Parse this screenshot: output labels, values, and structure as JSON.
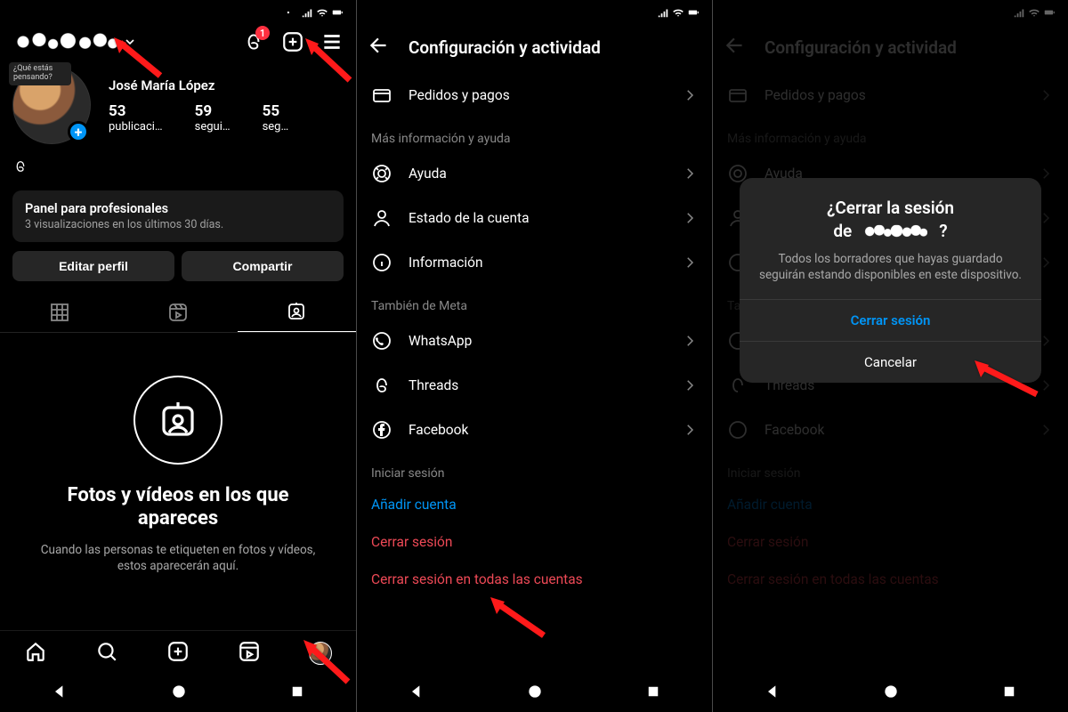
{
  "status": {
    "badge": "1"
  },
  "profile": {
    "story_prompt": "¿Qué estás pensando?",
    "display_name": "José María López",
    "stats": {
      "posts": {
        "num": "53",
        "label": "publicaci…"
      },
      "followers": {
        "num": "59",
        "label": "segui…"
      },
      "following": {
        "num": "55",
        "label": "seg…"
      }
    },
    "pro_panel": {
      "title": "Panel para profesionales",
      "subtitle": "3 visualizaciones en los últimos 30 días."
    },
    "buttons": {
      "edit": "Editar perfil",
      "share": "Compartir"
    },
    "empty": {
      "title": "Fotos y vídeos en los que apareces",
      "subtitle": "Cuando las personas te etiqueten en fotos y vídeos, estos aparecerán aquí."
    }
  },
  "settings": {
    "title": "Configuración y actividad",
    "rows": {
      "orders": "Pedidos y pagos",
      "help_section": "Más información y ayuda",
      "help": "Ayuda",
      "account_status": "Estado de la cuenta",
      "info": "Información",
      "meta_section": "También de Meta",
      "whatsapp": "WhatsApp",
      "threads": "Threads",
      "facebook": "Facebook",
      "login_section": "Iniciar sesión",
      "add_account": "Añadir cuenta",
      "logout": "Cerrar sesión",
      "logout_all": "Cerrar sesión en todas las cuentas"
    }
  },
  "dialog": {
    "title_pre": "¿Cerrar la sesión",
    "title_de": "de",
    "title_q": "?",
    "message": "Todos los borradores que hayas guardado seguirán estando disponibles en este dispositivo.",
    "confirm": "Cerrar sesión",
    "cancel": "Cancelar"
  }
}
